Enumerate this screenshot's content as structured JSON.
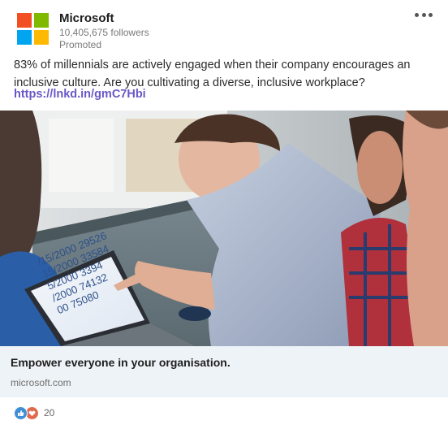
{
  "header": {
    "company": "Microsoft",
    "followers": "10,405,675 followers",
    "promoted": "Promoted",
    "more_icon": "ellipsis-icon"
  },
  "post": {
    "text": "83% of millennials are actively engaged when their company encourages an inclusive culture. Are you cultivating a diverse, inclusive workplace?",
    "link": "https://lnkd.in/gmC7Hbi"
  },
  "image": {
    "laptop_lines": [
      "/15/2000  29526",
      "15/2000  33584",
      "5/2000  3394",
      "/2000  74132",
      "00  75080"
    ]
  },
  "cta": {
    "title": "Empower everyone in your organisation.",
    "domain": "microsoft.com"
  },
  "reactions": {
    "icons": [
      "like-icon",
      "love-icon"
    ],
    "count": "20"
  },
  "colors": {
    "logo_red": "#f25022",
    "logo_green": "#7fba00",
    "logo_blue": "#00a4ef",
    "logo_yellow": "#ffb900",
    "link": "#6a57c7",
    "cta_background": "#eef3f7"
  }
}
